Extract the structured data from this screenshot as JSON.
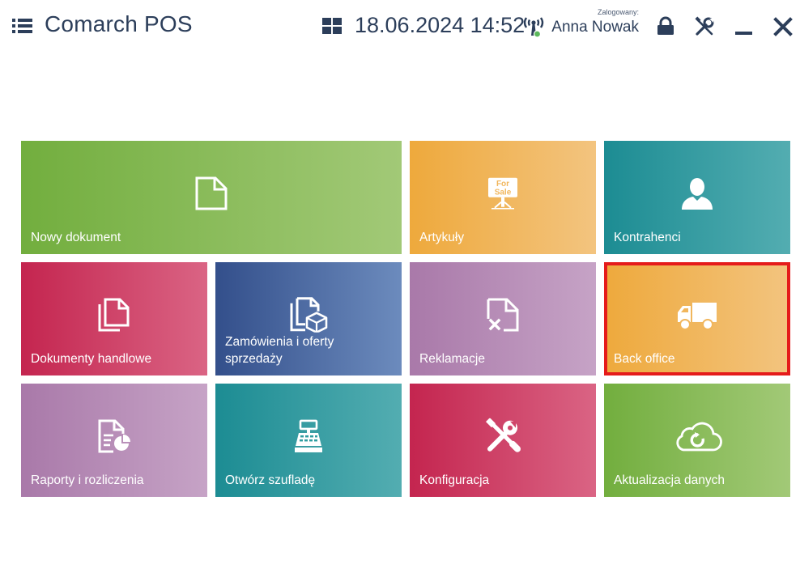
{
  "header": {
    "app_title": "Comarch POS",
    "datetime": "18.06.2024 14:52",
    "user_caption": "Zalogowany:",
    "user_name": "Anna Nowak",
    "icons": [
      "menu-icon",
      "grid-icon",
      "antenna-icon",
      "lock-icon",
      "tools-icon",
      "minimize-icon",
      "close-icon"
    ]
  },
  "tiles": [
    {
      "label": "Nowy dokument",
      "icon": "document-icon",
      "color": "#8bbf5c"
    },
    {
      "label": "Artykuły",
      "icon": "for-sale-sign-icon",
      "color": "#f1b65c",
      "icon_text": [
        "For",
        "Sale"
      ]
    },
    {
      "label": "Kontrahenci",
      "icon": "person-icon",
      "color": "#3a9ea4"
    },
    {
      "label": "Dokumenty handlowe",
      "icon": "documents-icon",
      "color": "#d0456a"
    },
    {
      "label": "Zamówienia i oferty sprzedaży",
      "icon": "documents-box-icon",
      "color": "#4d6aa3"
    },
    {
      "label": "Reklamacje",
      "icon": "document-x-icon",
      "color": "#b88db8"
    },
    {
      "label": "Back office",
      "icon": "truck-icon",
      "color": "#f1b65c",
      "selected": true
    },
    {
      "label": "Raporty i rozliczenia",
      "icon": "report-icon",
      "color": "#b88db8"
    },
    {
      "label": "Otwórz szufladę",
      "icon": "cash-register-icon",
      "color": "#2f9da0"
    },
    {
      "label": "Konfiguracja",
      "icon": "tools-icon",
      "color": "#d0456a"
    },
    {
      "label": "Aktualizacja danych",
      "icon": "cloud-refresh-icon",
      "color": "#8bbf5c"
    }
  ],
  "colors": {
    "accent_selected": "#e51b1b",
    "header_text": "#2c3e5a",
    "status_dot": "#5cb85c"
  }
}
